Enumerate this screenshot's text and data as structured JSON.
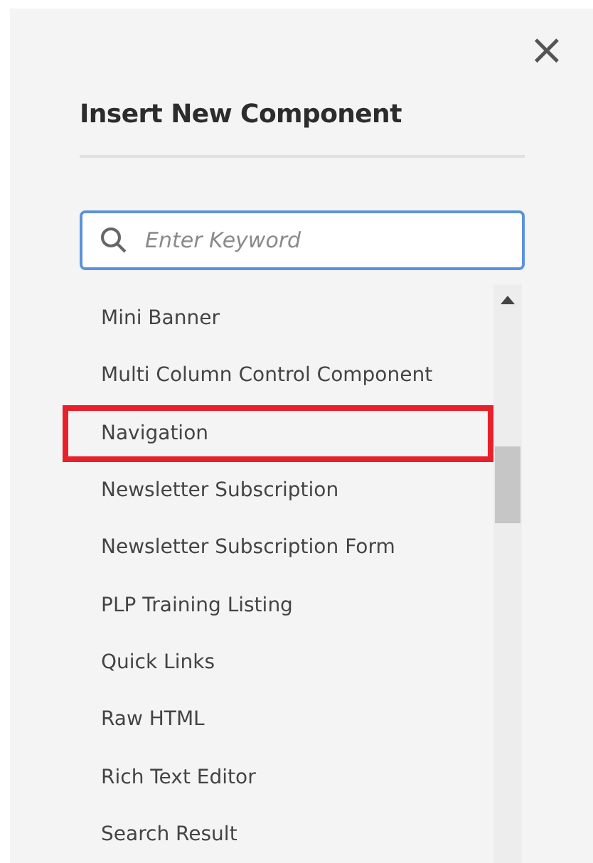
{
  "dialog": {
    "title": "Insert New Component",
    "close": "×"
  },
  "search": {
    "placeholder": "Enter Keyword"
  },
  "components": [
    {
      "label": "Mini Banner",
      "highlighted": false
    },
    {
      "label": "Multi Column Control Component",
      "highlighted": false
    },
    {
      "label": "Navigation",
      "highlighted": true
    },
    {
      "label": "Newsletter Subscription",
      "highlighted": false
    },
    {
      "label": "Newsletter Subscription Form",
      "highlighted": false
    },
    {
      "label": "PLP Training Listing",
      "highlighted": false
    },
    {
      "label": "Quick Links",
      "highlighted": false
    },
    {
      "label": "Raw HTML",
      "highlighted": false
    },
    {
      "label": "Rich Text Editor",
      "highlighted": false
    },
    {
      "label": "Search Result",
      "highlighted": false
    }
  ]
}
